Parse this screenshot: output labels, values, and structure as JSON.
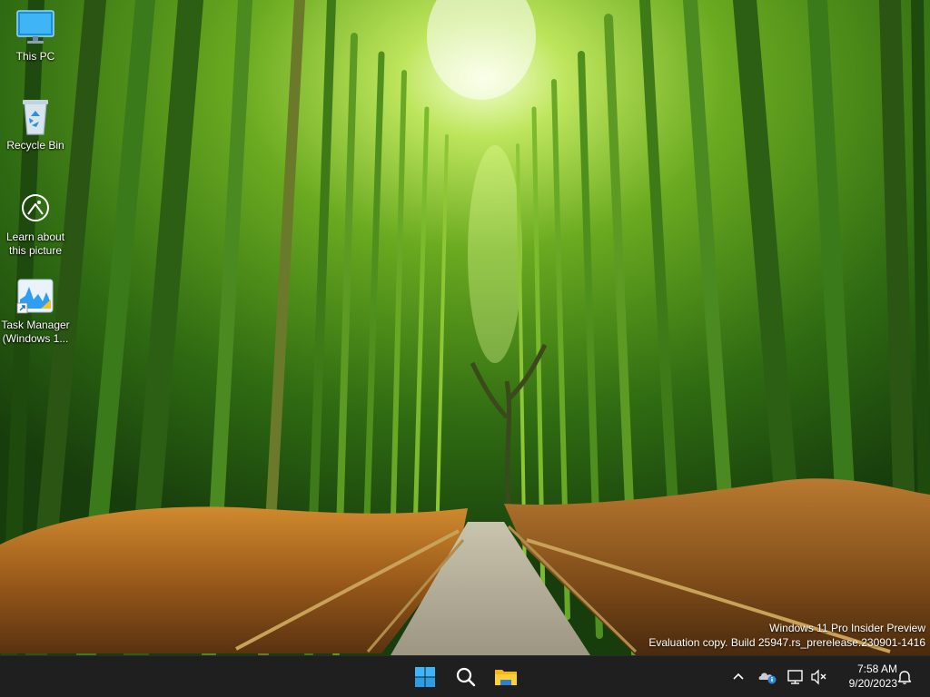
{
  "desktop": {
    "icons": [
      {
        "label": "This PC",
        "icon": "computer-monitor-icon"
      },
      {
        "label": "Recycle Bin",
        "icon": "recycle-bin-icon"
      },
      {
        "label": "Learn about\nthis picture",
        "icon": "learn-about-picture-icon"
      },
      {
        "label": "Task Manager\n(Windows 1...",
        "icon": "task-manager-icon"
      }
    ]
  },
  "watermark": {
    "line1": "Windows 11 Pro Insider Preview",
    "line2": "Evaluation copy. Build 25947.rs_prerelease.230901-1416"
  },
  "taskbar": {
    "pinned": [
      {
        "name": "Start",
        "icon": "windows-start-icon"
      },
      {
        "name": "Search",
        "icon": "search-icon"
      },
      {
        "name": "File Explorer",
        "icon": "folder-icon"
      }
    ],
    "tray": {
      "icons": [
        "chevron-up-icon",
        "onedrive-icon",
        "network-icon",
        "volume-muted-icon",
        "notification-bell-icon"
      ],
      "time": "7:58 AM",
      "date": "9/20/2023"
    }
  },
  "colors": {
    "taskbar": "#1f1f1f",
    "windows_accent": "#2fb2f7",
    "bamboo_light": "#b6e25a",
    "bamboo_dark": "#1e4f10",
    "grass": "#b06a1e"
  }
}
